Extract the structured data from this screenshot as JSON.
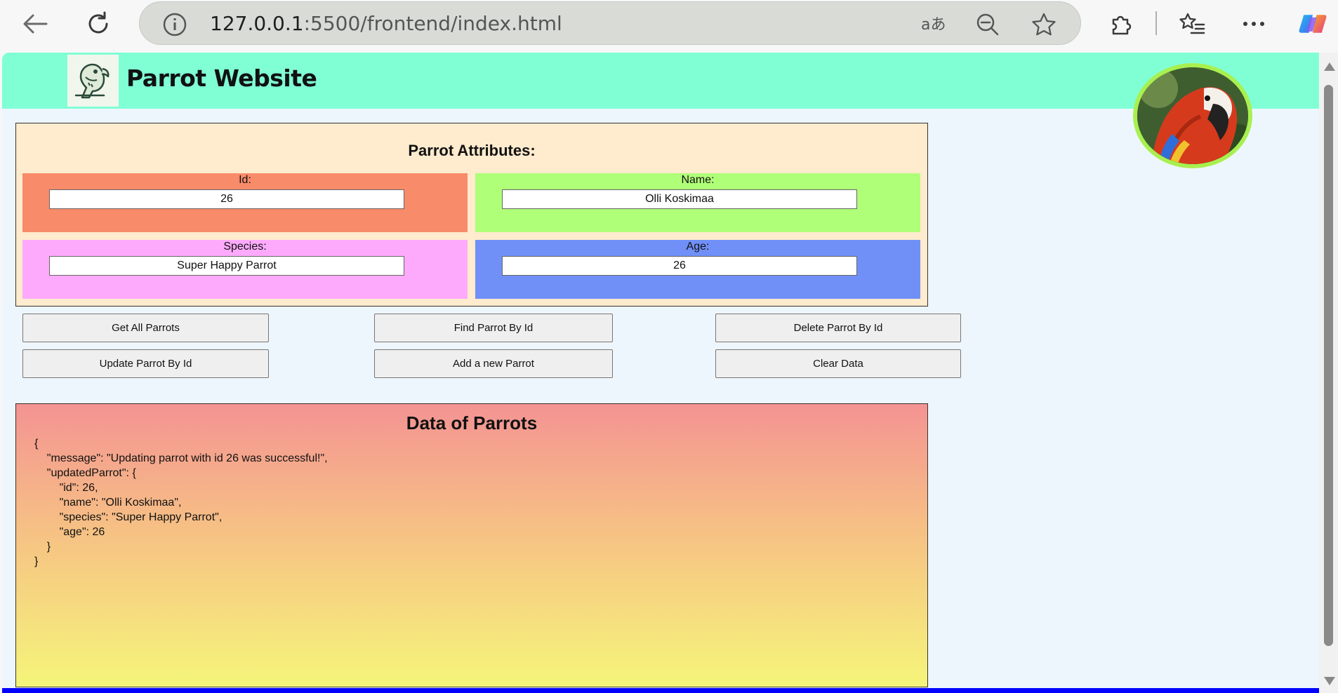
{
  "browser": {
    "url_host": "127.0.0.1",
    "url_rest": ":5500/frontend/index.html"
  },
  "header": {
    "title": "Parrot Website"
  },
  "attributes": {
    "title": "Parrot Attributes:",
    "id_label": "Id:",
    "id_value": "26",
    "name_label": "Name:",
    "name_value": "Olli Koskimaa",
    "species_label": "Species:",
    "species_value": "Super Happy Parrot",
    "age_label": "Age:",
    "age_value": "26"
  },
  "buttons": {
    "get_all": "Get All Parrots",
    "find_by_id": "Find Parrot By Id",
    "delete_by_id": "Delete Parrot By Id",
    "update_by_id": "Update Parrot By Id",
    "add_new": "Add a new Parrot",
    "clear": "Clear Data"
  },
  "data_panel": {
    "title": "Data of Parrots",
    "content": "{\n    \"message\": \"Updating parrot with id 26 was successful!\",\n    \"updatedParrot\": {\n        \"id\": 26,\n        \"name\": \"Olli Koskimaa\",\n        \"species\": \"Super Happy Parrot\",\n        \"age\": 26\n    }\n}"
  },
  "colors": {
    "header_bg": "#80ffd5",
    "id_box": "#f88b6a",
    "name_box": "#b0ff78",
    "species_box": "#fdaafd",
    "age_box": "#7090f8"
  }
}
